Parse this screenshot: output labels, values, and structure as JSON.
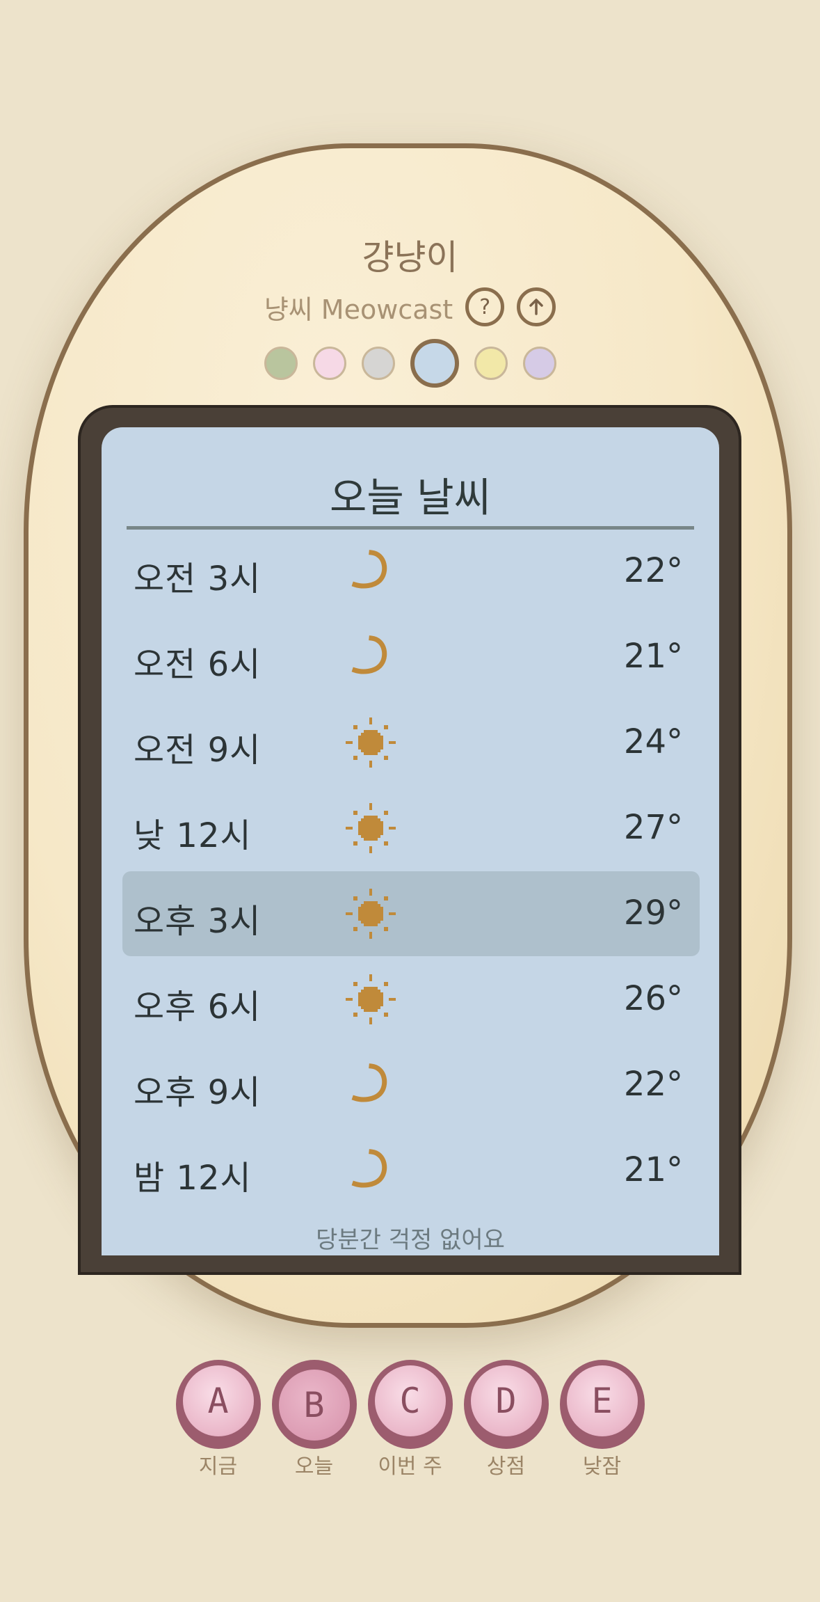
{
  "pet": {
    "name": "걍냥이"
  },
  "header": {
    "subtitle": "냥씨 Meowcast",
    "help_icon": "?",
    "share_icon": "↑"
  },
  "themes": [
    {
      "color": "#b9c59e",
      "selected": false
    },
    {
      "color": "#f6d9e6",
      "selected": false
    },
    {
      "color": "#d6d5d3",
      "selected": false
    },
    {
      "color": "#c6d8e8",
      "selected": true
    },
    {
      "color": "#f2e8a8",
      "selected": false
    },
    {
      "color": "#d6cbe6",
      "selected": false
    }
  ],
  "screen": {
    "title": "오늘 날씨",
    "footer": "당분간 걱정 없어요",
    "hours": [
      {
        "label": "오전 3시",
        "icon": "moon-icon",
        "temp": "22°",
        "selected": false
      },
      {
        "label": "오전 6시",
        "icon": "moon-icon",
        "temp": "21°",
        "selected": false
      },
      {
        "label": "오전 9시",
        "icon": "sun-icon",
        "temp": "24°",
        "selected": false
      },
      {
        "label": "낮 12시",
        "icon": "sun-icon",
        "temp": "27°",
        "selected": false
      },
      {
        "label": "오후 3시",
        "icon": "sun-icon",
        "temp": "29°",
        "selected": true
      },
      {
        "label": "오후 6시",
        "icon": "sun-icon",
        "temp": "26°",
        "selected": false
      },
      {
        "label": "오후 9시",
        "icon": "moon-icon",
        "temp": "22°",
        "selected": false
      },
      {
        "label": "밤 12시",
        "icon": "moon-icon",
        "temp": "21°",
        "selected": false
      }
    ]
  },
  "buttons": [
    {
      "letter": "A",
      "label": "지금",
      "pressed": false
    },
    {
      "letter": "B",
      "label": "오늘",
      "pressed": true
    },
    {
      "letter": "C",
      "label": "이번 주",
      "pressed": false
    },
    {
      "letter": "D",
      "label": "상점",
      "pressed": false
    },
    {
      "letter": "E",
      "label": "낮잠",
      "pressed": false
    }
  ],
  "colors": {
    "background": "#ede3cb",
    "device_border": "#8a6e4d",
    "screen": "#c5d6e6",
    "icon_gold": "#c08a3a",
    "button_pink": "#eab7c9"
  }
}
